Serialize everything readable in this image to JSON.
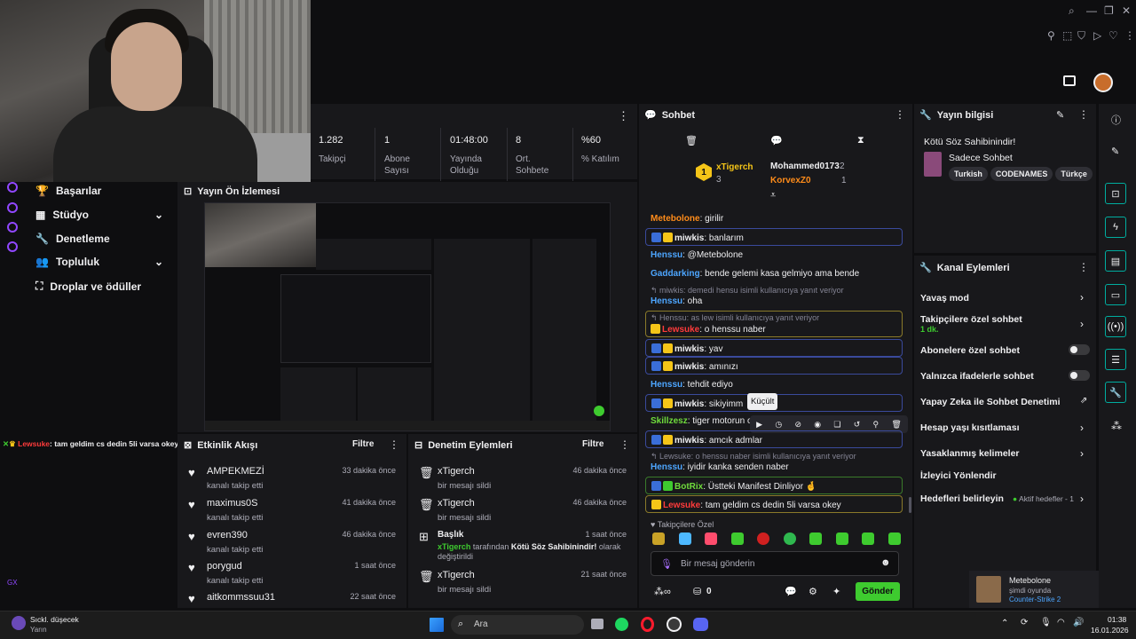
{
  "stats": [
    {
      "value": "1.282",
      "label": "Takipçi"
    },
    {
      "value": "1",
      "label": "Abone Sayısı"
    },
    {
      "value": "01:48:00",
      "label": "Yayında Olduğu"
    },
    {
      "value": "8",
      "label": "Ort. Sohbete"
    },
    {
      "value": "%60",
      "label": "% Katılım"
    }
  ],
  "nav": {
    "items": [
      {
        "label": "Başarılar"
      },
      {
        "label": "Stüdyo"
      },
      {
        "label": "Denetleme"
      },
      {
        "label": "Topluluk"
      },
      {
        "label": "Droplar ve ödüller"
      }
    ],
    "gx_label": "GX"
  },
  "overlay_message": {
    "user": "Lewsuke",
    "text": ": tam geldim cs dedin 5li varsa okey"
  },
  "preview": {
    "title": "Yayın Ön İzlemesi"
  },
  "activity": {
    "title": "Etkinlik Akışı",
    "filter": "Filtre",
    "items": [
      {
        "name": "AMPEKMEZİ",
        "sub": "kanalı takip etti",
        "time": "33 dakika önce"
      },
      {
        "name": "maximus0S",
        "sub": "kanalı takip etti",
        "time": "41 dakika önce"
      },
      {
        "name": "evren390",
        "sub": "kanalı takip etti",
        "time": "46 dakika önce"
      },
      {
        "name": "porygud",
        "sub": "kanalı takip etti",
        "time": "1 saat önce"
      },
      {
        "name": "aitkommssuu31",
        "sub": "",
        "time": "22 saat önce"
      }
    ]
  },
  "moderation": {
    "title": "Denetim Eylemleri",
    "filter": "Filtre",
    "items": [
      {
        "name": "xTigerch",
        "sub": "bir mesajı sildi",
        "time": "46 dakika önce"
      },
      {
        "name": "xTigerch",
        "sub": "bir mesajı sildi",
        "time": "46 dakika önce"
      },
      {
        "name": "Başlık",
        "sub_user": "xTigerch",
        "sub_mid": " tarafından ",
        "sub_title": "Kötü Söz Sahibinindir!",
        "sub_end": " olarak",
        "sub2": "değiştirildi",
        "time": "1 saat önce"
      },
      {
        "name": "xTigerch",
        "sub": "bir mesajı sildi",
        "time": "21 saat önce"
      }
    ]
  },
  "chat": {
    "title": "Sohbet",
    "leaderboard": {
      "first": {
        "rank": "1",
        "name": "xTigerch",
        "count": "3"
      },
      "second": {
        "name": "Mohammed0173",
        "count": "2"
      },
      "third": {
        "name": "KorvexZ0",
        "count": "1"
      }
    },
    "messages": [
      {
        "user": "Metebolone",
        "color": "#ff8c1a",
        "text": ": girilir"
      },
      {
        "user": "miwkis",
        "color": "#efeff1",
        "text": ": banlarım"
      },
      {
        "user": "Henssu",
        "color": "#4da6ff",
        "text": ": @Metebolone"
      },
      {
        "user": "Gaddarking",
        "color": "#4da6ff",
        "text": ": bende gelemi kasa gelmiyo ama bende"
      },
      {
        "reply": "miwkis: demedi hensu isimli kullanıcıya yanıt veriyor"
      },
      {
        "user": "Henssu",
        "color": "#4da6ff",
        "text": ": oha"
      },
      {
        "reply": "Henssu: as lew isimli kullanıcıya yanıt veriyor"
      },
      {
        "user": "Lewsuke",
        "color": "#ff3b3b",
        "text": ": o henssu naber"
      },
      {
        "user": "miwkis",
        "color": "#efeff1",
        "text": ": yav"
      },
      {
        "user": "miwkis",
        "color": "#efeff1",
        "text": ": amınızı"
      },
      {
        "user": "Henssu",
        "color": "#4da6ff",
        "text": ": tehdit ediyo"
      },
      {
        "user": "miwkis",
        "color": "#efeff1",
        "text": ": sikiyimm"
      },
      {
        "user": "Skillzesz",
        "color": "#6fdc3c",
        "text": ": tiger motorun olsa"
      },
      {
        "user": "miwkis",
        "color": "#efeff1",
        "text": ": amcık admlar"
      },
      {
        "reply": "Lewsuke: o henssu naber isimli kullanıcıya yanıt veriyor"
      },
      {
        "user": "Henssu",
        "color": "#4da6ff",
        "text": ": iyidir kanka senden naber"
      },
      {
        "user": "BotRix",
        "color": "#6fdc3c",
        "text": ": Üstteki Manifest Dinliyor 🤞"
      },
      {
        "user": "Lewsuke",
        "color": "#ff3b3b",
        "text": ": tam geldim cs dedin 5li varsa okey"
      }
    ],
    "tooltip": "Küçült",
    "emote_label": "Takipçilere Özel",
    "input_placeholder": "Bir mesaj gönderin",
    "points": "0",
    "send": "Gönder"
  },
  "stream_info": {
    "title": "Yayın bilgisi",
    "stream_title": "Kötü Söz Sahibinindir!",
    "category": "Sadece Sohbet",
    "tags": [
      "Turkish",
      "CODENAMES",
      "Türkçe"
    ]
  },
  "channel_actions": {
    "title": "Kanal Eylemleri",
    "rows": [
      {
        "label": "Yavaş mod"
      },
      {
        "label": "Takipçilere özel sohbet",
        "sub": "1 dk."
      },
      {
        "label": "Abonelere özel sohbet"
      },
      {
        "label": "Yalnızca ifadelerle sohbet"
      },
      {
        "label": "Yapay Zeka ile Sohbet Denetimi"
      },
      {
        "label": "Hesap yaşı kısıtlaması"
      },
      {
        "label": "Yasaklanmış kelimeler"
      },
      {
        "label": "İzleyici Yönlendir"
      },
      {
        "label": "Hedefleri belirleyin",
        "sub": "Aktif hedefler - 1"
      }
    ]
  },
  "notification": {
    "name": "Metebolone",
    "status": "şimdi oyunda",
    "game": "Counter-Strike 2"
  },
  "taskbar": {
    "weather_title": "Sıckl. düşecek",
    "weather_sub": "Yarın",
    "search": "Ara",
    "time": "01:38",
    "date": "16.01.2026"
  },
  "colors": {
    "accent": "#3ecb2f",
    "panel": "#18181b",
    "bg": "#0e0e10",
    "purple": "#9147ff",
    "teal": "#00ad9f"
  }
}
